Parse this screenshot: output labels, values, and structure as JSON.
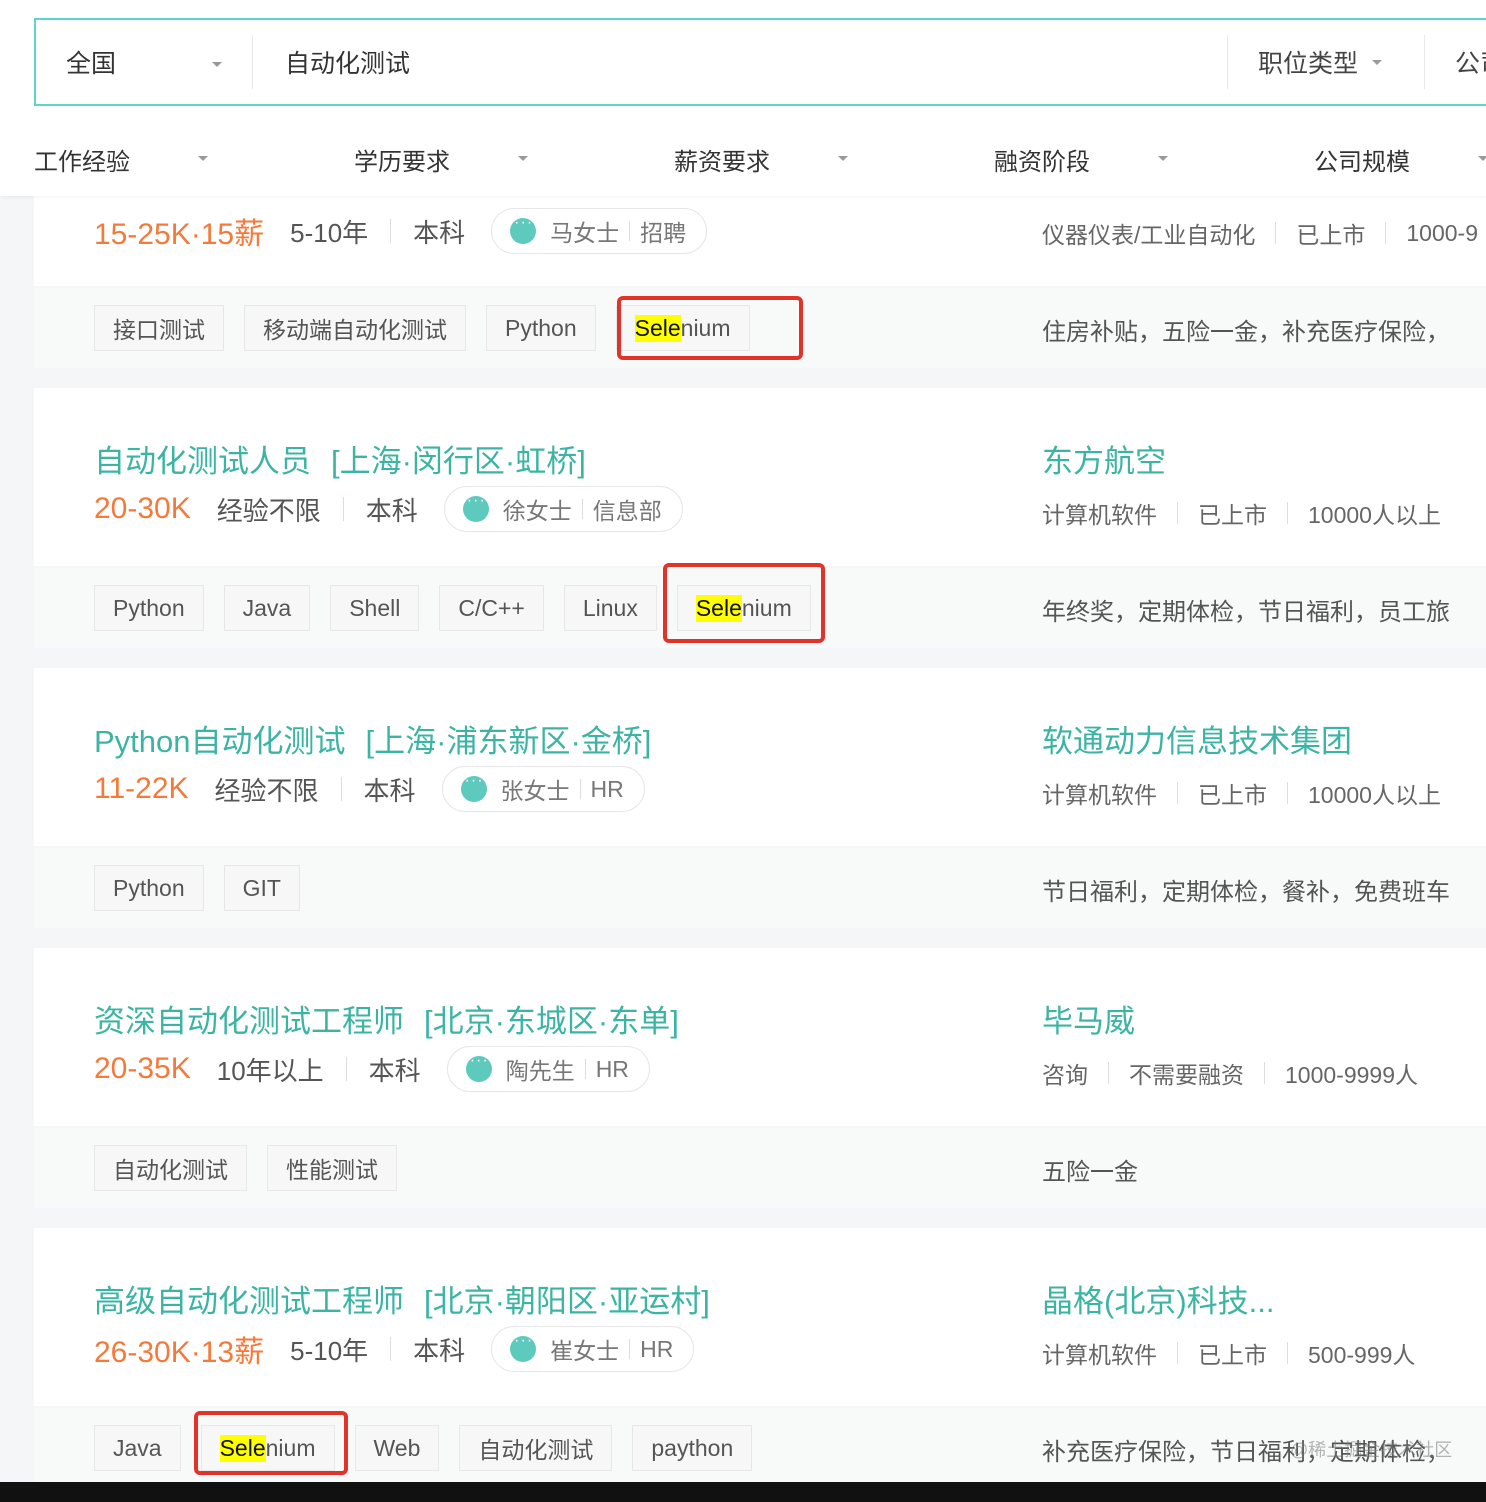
{
  "search": {
    "city": "全国",
    "query": "自动化测试",
    "job_type": "职位类型",
    "company_partial": "公司"
  },
  "filters": [
    "工作经验",
    "学历要求",
    "薪资要求",
    "融资阶段",
    "公司规模"
  ],
  "jobs": [
    {
      "salary": "15-25K·15薪",
      "experience": "5-10年",
      "education": "本科",
      "hr_name": "马女士",
      "hr_role": "招聘",
      "company_info": [
        "仪器仪表/工业自动化",
        "已上市",
        "1000-9"
      ],
      "tags": [
        "接口测试",
        "移动端自动化测试",
        "Python",
        "Selenium"
      ],
      "benefits": "住房补贴，五险一金，补充医疗保险，"
    },
    {
      "title": "自动化测试人员",
      "location": "[上海·闵行区·虹桥]",
      "salary": "20-30K",
      "experience": "经验不限",
      "education": "本科",
      "hr_name": "徐女士",
      "hr_role": "信息部",
      "company": "东方航空",
      "company_info": [
        "计算机软件",
        "已上市",
        "10000人以上"
      ],
      "tags": [
        "Python",
        "Java",
        "Shell",
        "C/C++",
        "Linux",
        "Selenium"
      ],
      "benefits": "年终奖，定期体检，节日福利，员工旅"
    },
    {
      "title": "Python自动化测试",
      "location": "[上海·浦东新区·金桥]",
      "salary": "11-22K",
      "experience": "经验不限",
      "education": "本科",
      "hr_name": "张女士",
      "hr_role": "HR",
      "company": "软通动力信息技术集团",
      "company_info": [
        "计算机软件",
        "已上市",
        "10000人以上"
      ],
      "tags": [
        "Python",
        "GIT"
      ],
      "benefits": "节日福利，定期体检，餐补，免费班车"
    },
    {
      "title": "资深自动化测试工程师",
      "location": "[北京·东城区·东单]",
      "salary": "20-35K",
      "experience": "10年以上",
      "education": "本科",
      "hr_name": "陶先生",
      "hr_role": "HR",
      "company": "毕马威",
      "company_info": [
        "咨询",
        "不需要融资",
        "1000-9999人"
      ],
      "tags": [
        "自动化测试",
        "性能测试"
      ],
      "benefits": "五险一金"
    },
    {
      "title": "高级自动化测试工程师",
      "location": "[北京·朝阳区·亚运村]",
      "salary": "26-30K·13薪",
      "experience": "5-10年",
      "education": "本科",
      "hr_name": "崔女士",
      "hr_role": "HR",
      "company": "晶格(北京)科技...",
      "company_info": [
        "计算机软件",
        "已上市",
        "500-999人"
      ],
      "tags": [
        "Java",
        "Selenium",
        "Web",
        "自动化测试",
        "paython"
      ],
      "benefits": "补充医疗保险，节日福利，定期体检，"
    }
  ],
  "highlight": {
    "matched": "Sele",
    "rest": "nium"
  },
  "watermark": "@稀土掘金技术社区",
  "colors": {
    "accent": "#3cb4a4",
    "salary": "#f57939",
    "highlight": "#ffff00",
    "annotation": "#e2332b"
  }
}
